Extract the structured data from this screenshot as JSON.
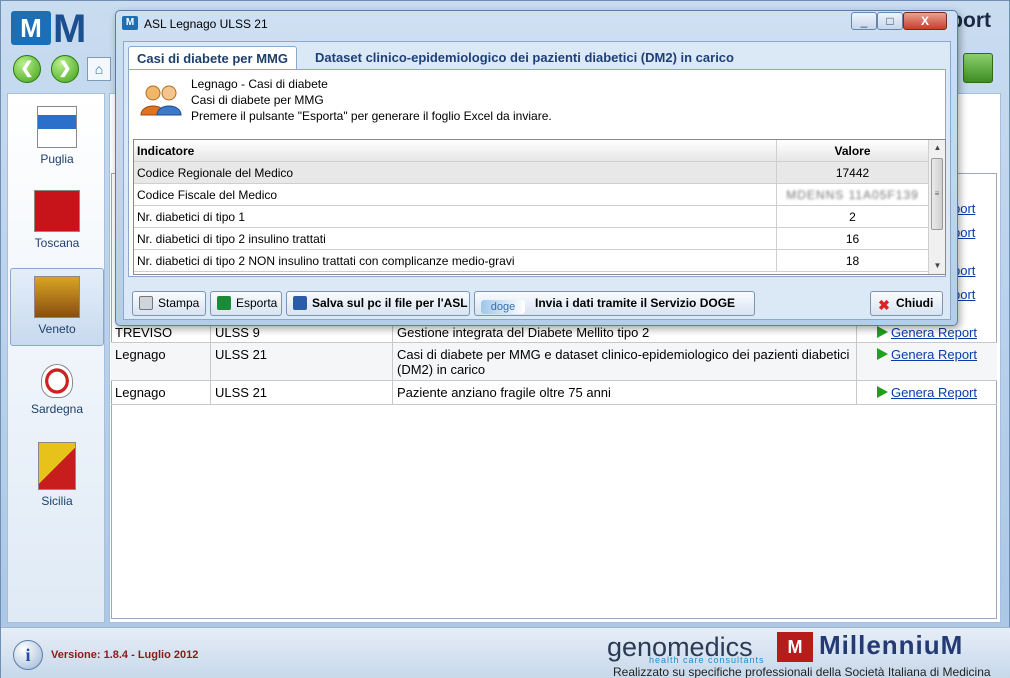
{
  "main_window": {
    "title_partial": "port",
    "logo_letter": "M"
  },
  "sidebar": {
    "items": [
      {
        "label": "Puglia"
      },
      {
        "label": "Toscana"
      },
      {
        "label": "Veneto"
      },
      {
        "label": "Sardegna"
      },
      {
        "label": "Sicilia"
      }
    ],
    "active": "Veneto"
  },
  "background_table": {
    "rows": [
      {
        "city": "TREVISO",
        "ulss": "ULSS 9",
        "report": "Gestione integrata del Diabete Mellito tipo 2",
        "action": "Genera Report"
      },
      {
        "city": "Legnago",
        "ulss": "ULSS 21",
        "report": "Casi di diabete per MMG e dataset clinico-epidemiologico dei pazienti diabetici (DM2) in carico",
        "action": "Genera Report"
      },
      {
        "city": "Legnago",
        "ulss": "ULSS 21",
        "report": "Paziente anziano fragile oltre 75 anni",
        "action": "Genera Report"
      }
    ],
    "partial_links": [
      "port",
      "port",
      "port",
      "port"
    ]
  },
  "footer": {
    "version": "Versione: 1.8.4 - Luglio 2012",
    "genomedics": "genomedics",
    "genomedics_sub": "health care consultants",
    "millennium": "MillenniuM",
    "credits": "Realizzato su specifiche professionali della Società Italiana di Medicina Generale"
  },
  "dialog": {
    "title": "ASL Legnago ULSS 21",
    "tabs": [
      {
        "label": "Casi di diabete per MMG"
      },
      {
        "label": "Dataset clinico-epidemiologico dei pazienti diabetici (DM2) in carico"
      }
    ],
    "description": {
      "line1": "Legnago - Casi di diabete",
      "line2": "Casi di diabete per MMG",
      "line3": "Premere il pulsante \"Esporta\" per generare il foglio Excel da inviare."
    },
    "grid": {
      "headers": {
        "indicator": "Indicatore",
        "value": "Valore"
      },
      "rows": [
        {
          "indicator": "Codice Regionale del Medico",
          "value": "17442"
        },
        {
          "indicator": "Codice Fiscale del Medico",
          "value": "MDENNS 11A05F139"
        },
        {
          "indicator": "Nr. diabetici di tipo 1",
          "value": "2"
        },
        {
          "indicator": "Nr. diabetici di tipo 2 insulino trattati",
          "value": "16"
        },
        {
          "indicator": "Nr. diabetici di tipo 2 NON insulino trattati con complicanze medio-gravi",
          "value": "18"
        }
      ]
    },
    "buttons": {
      "print": "Stampa",
      "export": "Esporta",
      "save_asl": "Salva sul pc il file per l'ASL",
      "doge_logo": "doge",
      "send_doge": "Invia i dati tramite il Servizio DOGE",
      "close": "Chiudi"
    },
    "win_buttons": {
      "minimize": "_",
      "maximize": "□",
      "close": "X"
    }
  }
}
